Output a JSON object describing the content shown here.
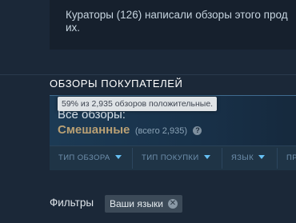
{
  "curators": {
    "line1": "Кураторы (126) написали обзоры этого прод",
    "line2": "их."
  },
  "section_title": "ОБЗОРЫ ПОКУПАТЕЛЕЙ",
  "summary": {
    "all_reviews_label": "Все обзоры:",
    "rating": "Смешанные",
    "total": "(всего 2,935)",
    "help_icon_glyph": "?",
    "tooltip": "59% из 2,935 обзоров положительные."
  },
  "filter_tabs": [
    {
      "label": "ТИП ОБЗОРА"
    },
    {
      "label": "ТИП ПОКУПКИ"
    },
    {
      "label": "ЯЗЫК"
    },
    {
      "label": "ПР"
    }
  ],
  "filters": {
    "label": "Фильтры",
    "chip_label": "Ваши языки",
    "chip_close_glyph": "✕"
  },
  "colors": {
    "background": "#1b2838",
    "rating_mixed": "#b9a074",
    "accent": "#66c0f4"
  }
}
